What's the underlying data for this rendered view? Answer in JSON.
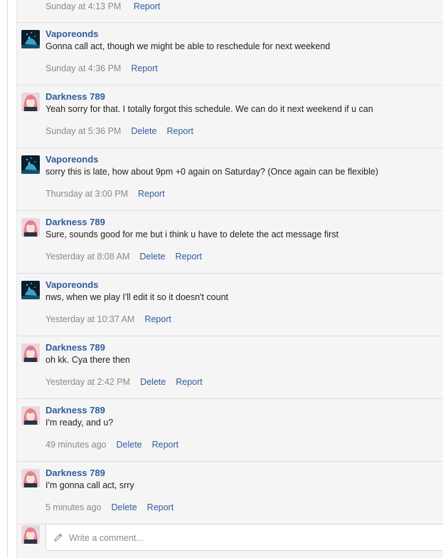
{
  "thread": {
    "partial_meta": {
      "time": "Sunday at 4:13 PM",
      "report": "Report"
    },
    "comments": [
      {
        "author": "Vaporeonds",
        "avatar": "vaporeonds-avatar",
        "text": "Gonna call act, though we might be able to reschedule for next weekend",
        "time": "Sunday at 4:36 PM",
        "delete": null,
        "report": "Report"
      },
      {
        "author": "Darkness 789",
        "avatar": "darkness-avatar",
        "text": "Yeah sorry for that. I totally forgot this schedule. We can do it next weekend if u can",
        "time": "Sunday at 5:36 PM",
        "delete": "Delete",
        "report": "Report"
      },
      {
        "author": "Vaporeonds",
        "avatar": "vaporeonds-avatar",
        "text": "sorry this is late, how about 9pm +0 again on Saturday? (Once again can be flexible)",
        "time": "Thursday at 3:00 PM",
        "delete": null,
        "report": "Report"
      },
      {
        "author": "Darkness 789",
        "avatar": "darkness-avatar",
        "text": "Sure, sounds good for me but i think u have to delete the act message first",
        "time": "Yesterday at 8:08 AM",
        "delete": "Delete",
        "report": "Report"
      },
      {
        "author": "Vaporeonds",
        "avatar": "vaporeonds-avatar",
        "text": "nws, when we play I'll edit it so it doesn't count",
        "time": "Yesterday at 10:37 AM",
        "delete": null,
        "report": "Report"
      },
      {
        "author": "Darkness 789",
        "avatar": "darkness-avatar",
        "text": "oh kk. Cya there then",
        "time": "Yesterday at 2:42 PM",
        "delete": "Delete",
        "report": "Report"
      },
      {
        "author": "Darkness 789",
        "avatar": "darkness-avatar",
        "text": "I'm ready, and u?",
        "time": "49 minutes ago",
        "delete": "Delete",
        "report": "Report"
      },
      {
        "author": "Darkness 789",
        "avatar": "darkness-avatar",
        "text": "I'm gonna call act, srry",
        "time": "5 minutes ago",
        "delete": "Delete",
        "report": "Report"
      }
    ]
  },
  "composer": {
    "placeholder": "Write a comment...",
    "icon": "pencil-icon",
    "avatar": "darkness-avatar"
  },
  "colors": {
    "link": "#2f5c9e",
    "meta": "#8a8a8a",
    "background": "#f5f5f5"
  }
}
